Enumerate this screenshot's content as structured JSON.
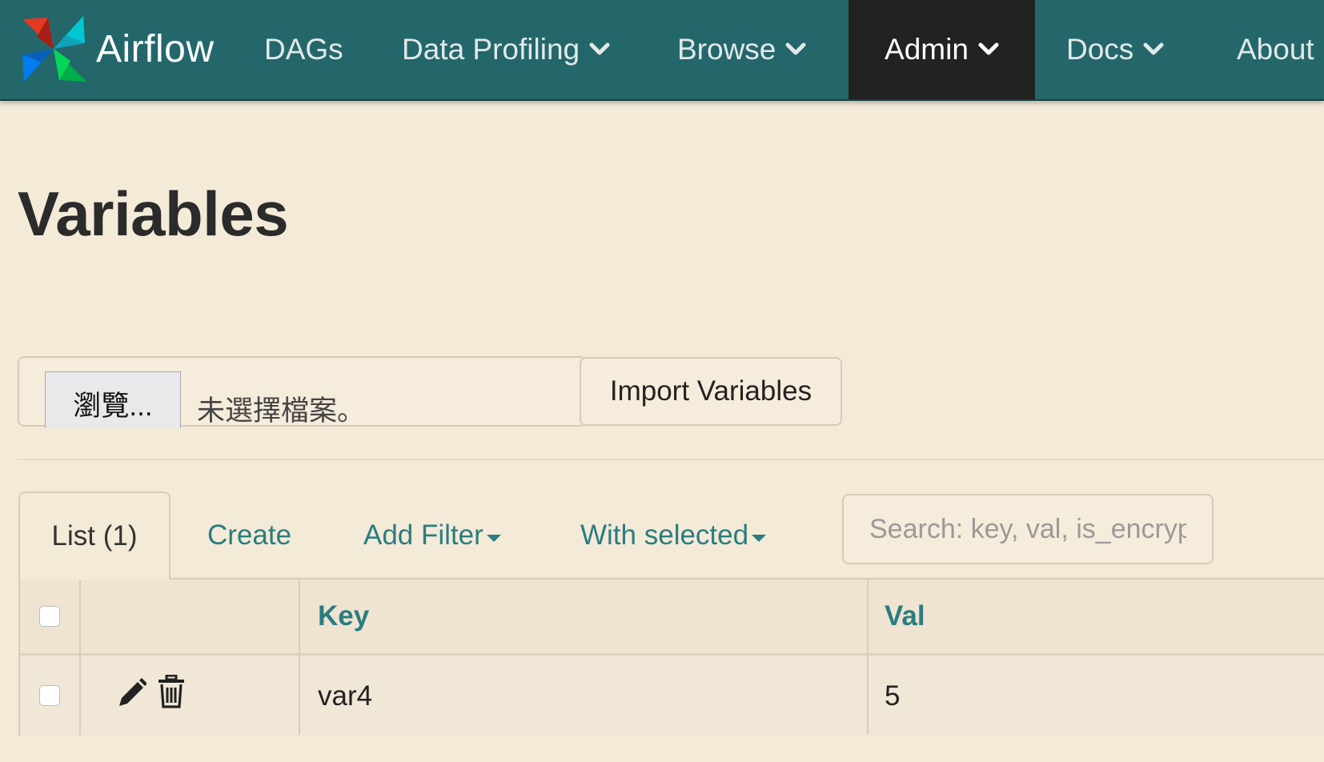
{
  "navbar": {
    "brand": "Airflow",
    "items": [
      {
        "label": "DAGs"
      },
      {
        "label": "Data Profiling"
      },
      {
        "label": "Browse"
      },
      {
        "label": "Admin"
      },
      {
        "label": "Docs"
      },
      {
        "label": "About"
      }
    ],
    "active_color": "#222222",
    "bar_color": "#24676b"
  },
  "page": {
    "title": "Variables"
  },
  "import": {
    "browse_label": "瀏覽...",
    "file_status": "未選擇檔案。",
    "import_label": "Import Variables"
  },
  "tabs": {
    "list_label": "List (1)",
    "create_label": "Create",
    "add_filter_label": "Add Filter",
    "with_selected_label": "With selected"
  },
  "search": {
    "placeholder": "Search: key, val, is_encrypted",
    "value": ""
  },
  "table": {
    "columns": [
      "",
      "",
      "Key",
      "Val"
    ],
    "rows": [
      {
        "key": "var4",
        "val": "5"
      }
    ]
  },
  "icons": {
    "edit": "pencil-icon",
    "delete": "trash-icon",
    "chevron": "chevron-down-icon",
    "logo": "pinwheel-logo"
  }
}
